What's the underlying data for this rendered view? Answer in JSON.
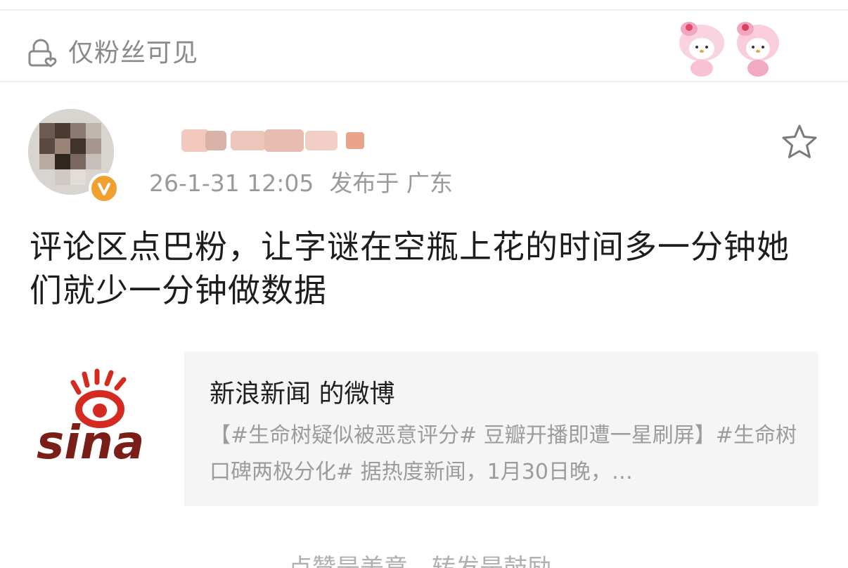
{
  "visibility": {
    "icon": "lock-heart-icon",
    "label": "仅粉丝可见"
  },
  "post": {
    "author": {
      "verified_icon": "verified-badge-icon"
    },
    "timestamp": "26-1-31 12:05",
    "location": "发布于 广东",
    "text": "评论区点巴粉，让字谜在空瓶上花的时间多一分钟她们就少一分钟做数据"
  },
  "link_card": {
    "logo_text": "sina",
    "title": "新浪新闻 的微博",
    "description": "【#生命树疑似被恶意评分# 豆瓣开播即遭一星刷屏】#生命树口碑两极分化# 据热度新闻，1月30日晚，…"
  },
  "bottom_hint": "点赞是美意，转发是鼓励",
  "colors": {
    "accent": "#f0a030",
    "sina_red": "#d42a20",
    "sina_dark": "#7a1f18",
    "meta_gray": "#9a9a9a"
  }
}
